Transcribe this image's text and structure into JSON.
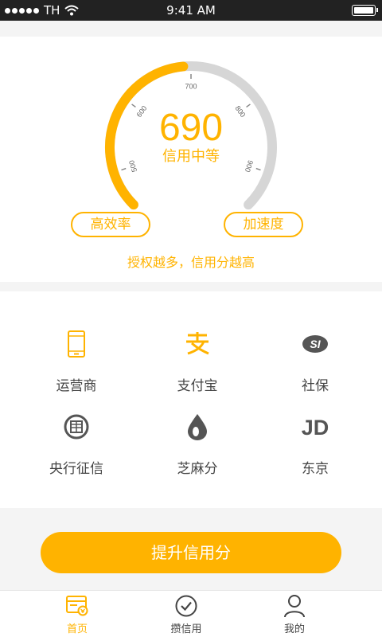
{
  "status_bar": {
    "carrier": "TH",
    "time": "9:41 AM"
  },
  "score": {
    "value": "690",
    "level": "信用中等",
    "gauge_min": 450,
    "gauge_max": 950,
    "gauge_fill_value": 690,
    "ticks": [
      "500",
      "600",
      "700",
      "800",
      "900"
    ],
    "accent_color": "#ffb300",
    "track_color": "#d6d6d6"
  },
  "buttons": {
    "efficiency": "高效率",
    "speed": "加速度"
  },
  "hint": "授权越多，信用分越高",
  "sources": [
    {
      "label": "运营商",
      "icon": "phone-icon"
    },
    {
      "label": "支付宝",
      "icon": "alipay-icon"
    },
    {
      "label": "社保",
      "icon": "social-security-icon"
    },
    {
      "label": "央行征信",
      "icon": "central-bank-icon"
    },
    {
      "label": "芝麻分",
      "icon": "sesame-icon"
    },
    {
      "label": "东京",
      "icon": "jd-icon",
      "glyph": "JD"
    }
  ],
  "cta": "提升信用分",
  "tabs": [
    {
      "label": "首页",
      "icon": "home-card-icon",
      "active": true
    },
    {
      "label": "攒信用",
      "icon": "check-circle-icon",
      "active": false
    },
    {
      "label": "我的",
      "icon": "user-icon",
      "active": false
    }
  ]
}
